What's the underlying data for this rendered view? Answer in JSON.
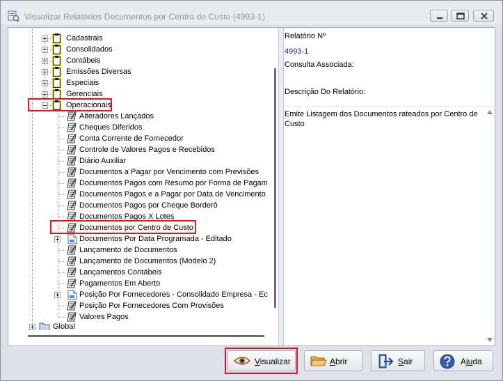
{
  "window": {
    "title": "Visualizar Relatórios Documentos por Centro de Custo (4993-1)",
    "highlight_color": "#e0141c"
  },
  "tree": {
    "groups": [
      {
        "label": "Cadastrais",
        "state": "collapsed"
      },
      {
        "label": "Consolidados",
        "state": "collapsed"
      },
      {
        "label": "Contábeis",
        "state": "collapsed"
      },
      {
        "label": "Emissões Diversas",
        "state": "collapsed"
      },
      {
        "label": "Especiais",
        "state": "collapsed"
      },
      {
        "label": "Gerenciais",
        "state": "collapsed"
      },
      {
        "label": "Operacionais",
        "state": "expanded",
        "highlighted": true
      }
    ],
    "items": [
      {
        "label": "Alteradores Lançados",
        "icon": "report-icon"
      },
      {
        "label": "Cheques Diferidos",
        "icon": "report-icon"
      },
      {
        "label": "Conta Corrente de Fornecedor",
        "icon": "report-icon"
      },
      {
        "label": "Controle de Valores Pagos e Recebidos",
        "icon": "report-icon"
      },
      {
        "label": "Diário Auxiliar",
        "icon": "report-icon"
      },
      {
        "label": "Documentos a Pagar por Vencimento com Previsões",
        "icon": "report-icon"
      },
      {
        "label": "Documentos Pagos com Resumo por Forma de Pagam",
        "icon": "report-icon"
      },
      {
        "label": "Documentos Pagos e a Pagar por Data de Vencimento",
        "icon": "report-icon"
      },
      {
        "label": "Documentos Pagos por Cheque Borderô",
        "icon": "report-icon"
      },
      {
        "label": "Documentos Pagos X Lotes",
        "icon": "report-icon"
      },
      {
        "label": "Documentos por Centro de Custo",
        "icon": "report-icon",
        "selected": true
      },
      {
        "label": "Documentos Por Data Programada - Editado",
        "icon": "document-icon",
        "expander": true
      },
      {
        "label": "Lançamento de Documentos",
        "icon": "report-icon"
      },
      {
        "label": "Lançamento de Documentos (Modelo 2)",
        "icon": "report-icon"
      },
      {
        "label": "Lançamentos Contábeis",
        "icon": "report-icon"
      },
      {
        "label": "Pagamentos Em Aberto",
        "icon": "report-icon"
      },
      {
        "label": "Posição Por Fornecedores - Consolidado Empresa - Ec",
        "icon": "document-icon",
        "expander": true
      },
      {
        "label": "Posição Por Fornecedores Com Provisões",
        "icon": "report-icon"
      },
      {
        "label": "Valores Pagos",
        "icon": "report-icon"
      }
    ],
    "root": {
      "label": "Global",
      "state": "collapsed"
    }
  },
  "details": {
    "report_number_label": "Relatório Nº",
    "report_number": "4993-1",
    "associated_query_label": "Consulta Associada:",
    "associated_query": "",
    "description_label": "Descrição Do Relatório:",
    "description": "Emite Listagem dos Documentos rateados por Centro de Custo"
  },
  "buttons": {
    "view_first": "V",
    "view_rest": "isualizar",
    "open_first": "A",
    "open_rest": "brir",
    "exit_first": "S",
    "exit_rest": "air",
    "help_prefix": "Aj",
    "help_u": "u",
    "help_rest": "da"
  }
}
